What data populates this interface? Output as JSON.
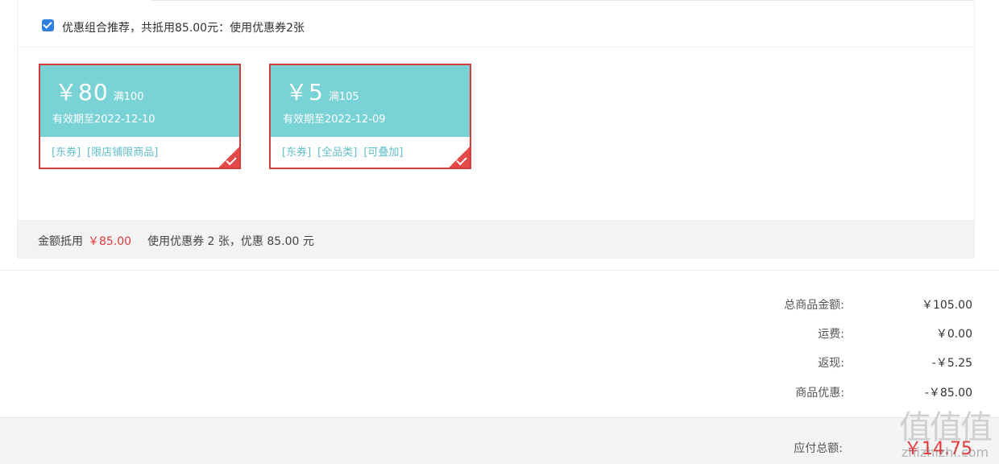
{
  "recommend": {
    "checked": true,
    "text": "优惠组合推荐，共抵用85.00元：使用优惠券2张"
  },
  "coupons": [
    {
      "symbol": "￥",
      "amount": "80",
      "threshold": "满100",
      "expiry": "有效期至2022-12-10",
      "tags": [
        "[东券]",
        "[限店铺限商品]"
      ],
      "selected": true
    },
    {
      "symbol": "￥",
      "amount": "5",
      "threshold": "满105",
      "expiry": "有效期至2022-12-09",
      "tags": [
        "[东券]",
        "[全品类]",
        "[可叠加]"
      ],
      "selected": true
    }
  ],
  "footer": {
    "label": "金额抵用",
    "amount": "￥85.00",
    "summary": "使用优惠券 2 张，优惠 85.00 元"
  },
  "summary": {
    "rows": [
      {
        "label": "总商品金额:",
        "value": "￥105.00"
      },
      {
        "label": "运费:",
        "value": "￥0.00"
      },
      {
        "label": "返现:",
        "value": "-￥5.25"
      },
      {
        "label": "商品优惠:",
        "value": "-￥85.00"
      }
    ],
    "total_label": "应付总额:",
    "total_value": "￥14.75"
  },
  "watermark": {
    "chars": "值值值",
    "url": "zhizhizhi.com"
  },
  "colors": {
    "coupon_bg": "#78d2d6",
    "coupon_border": "#d23b3b",
    "price_red": "#e4393c",
    "tag_text": "#5fbfc9"
  }
}
